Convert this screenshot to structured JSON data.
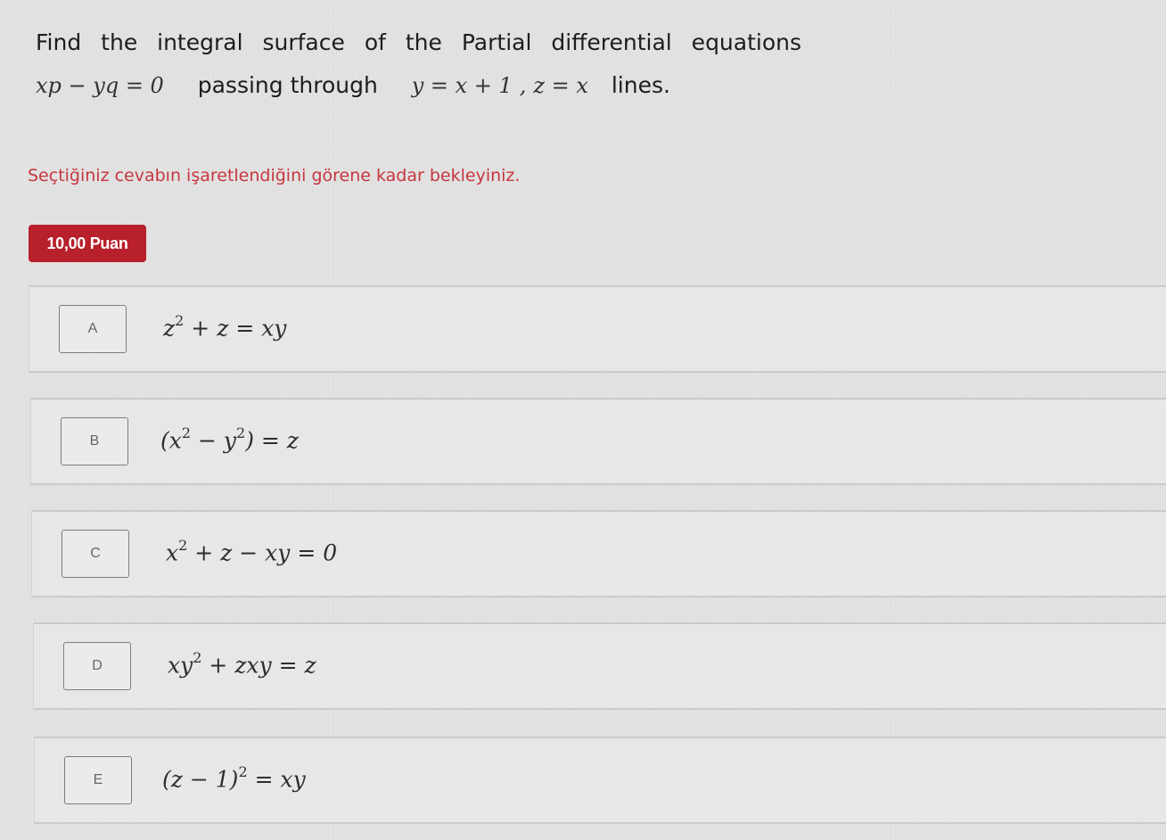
{
  "question": {
    "line1": "Find the integral surface of the Partial differential equations",
    "equation": "xp − yq = 0",
    "passing_text": "passing through",
    "line_eq1": "y = x + 1",
    "separator": ",",
    "line_eq2": "z = x",
    "lines_text": "lines."
  },
  "notice": "Seçtiğiniz cevabın işaretlendiğini görene kadar bekleyiniz.",
  "points_badge": "10,00 Puan",
  "colors": {
    "notice": "#c83640",
    "badge": "#b8202c"
  },
  "options": [
    {
      "letter": "A",
      "answer_html": "z<sup>2</sup> + z = xy"
    },
    {
      "letter": "B",
      "answer_html": "(x<sup>2</sup> − y<sup>2</sup>) = z"
    },
    {
      "letter": "C",
      "answer_html": "x<sup>2</sup> + z − xy = 0"
    },
    {
      "letter": "D",
      "answer_html": "xy<sup>2</sup> + zxy = z"
    },
    {
      "letter": "E",
      "answer_html": "(z − 1)<sup>2</sup> = xy"
    }
  ]
}
